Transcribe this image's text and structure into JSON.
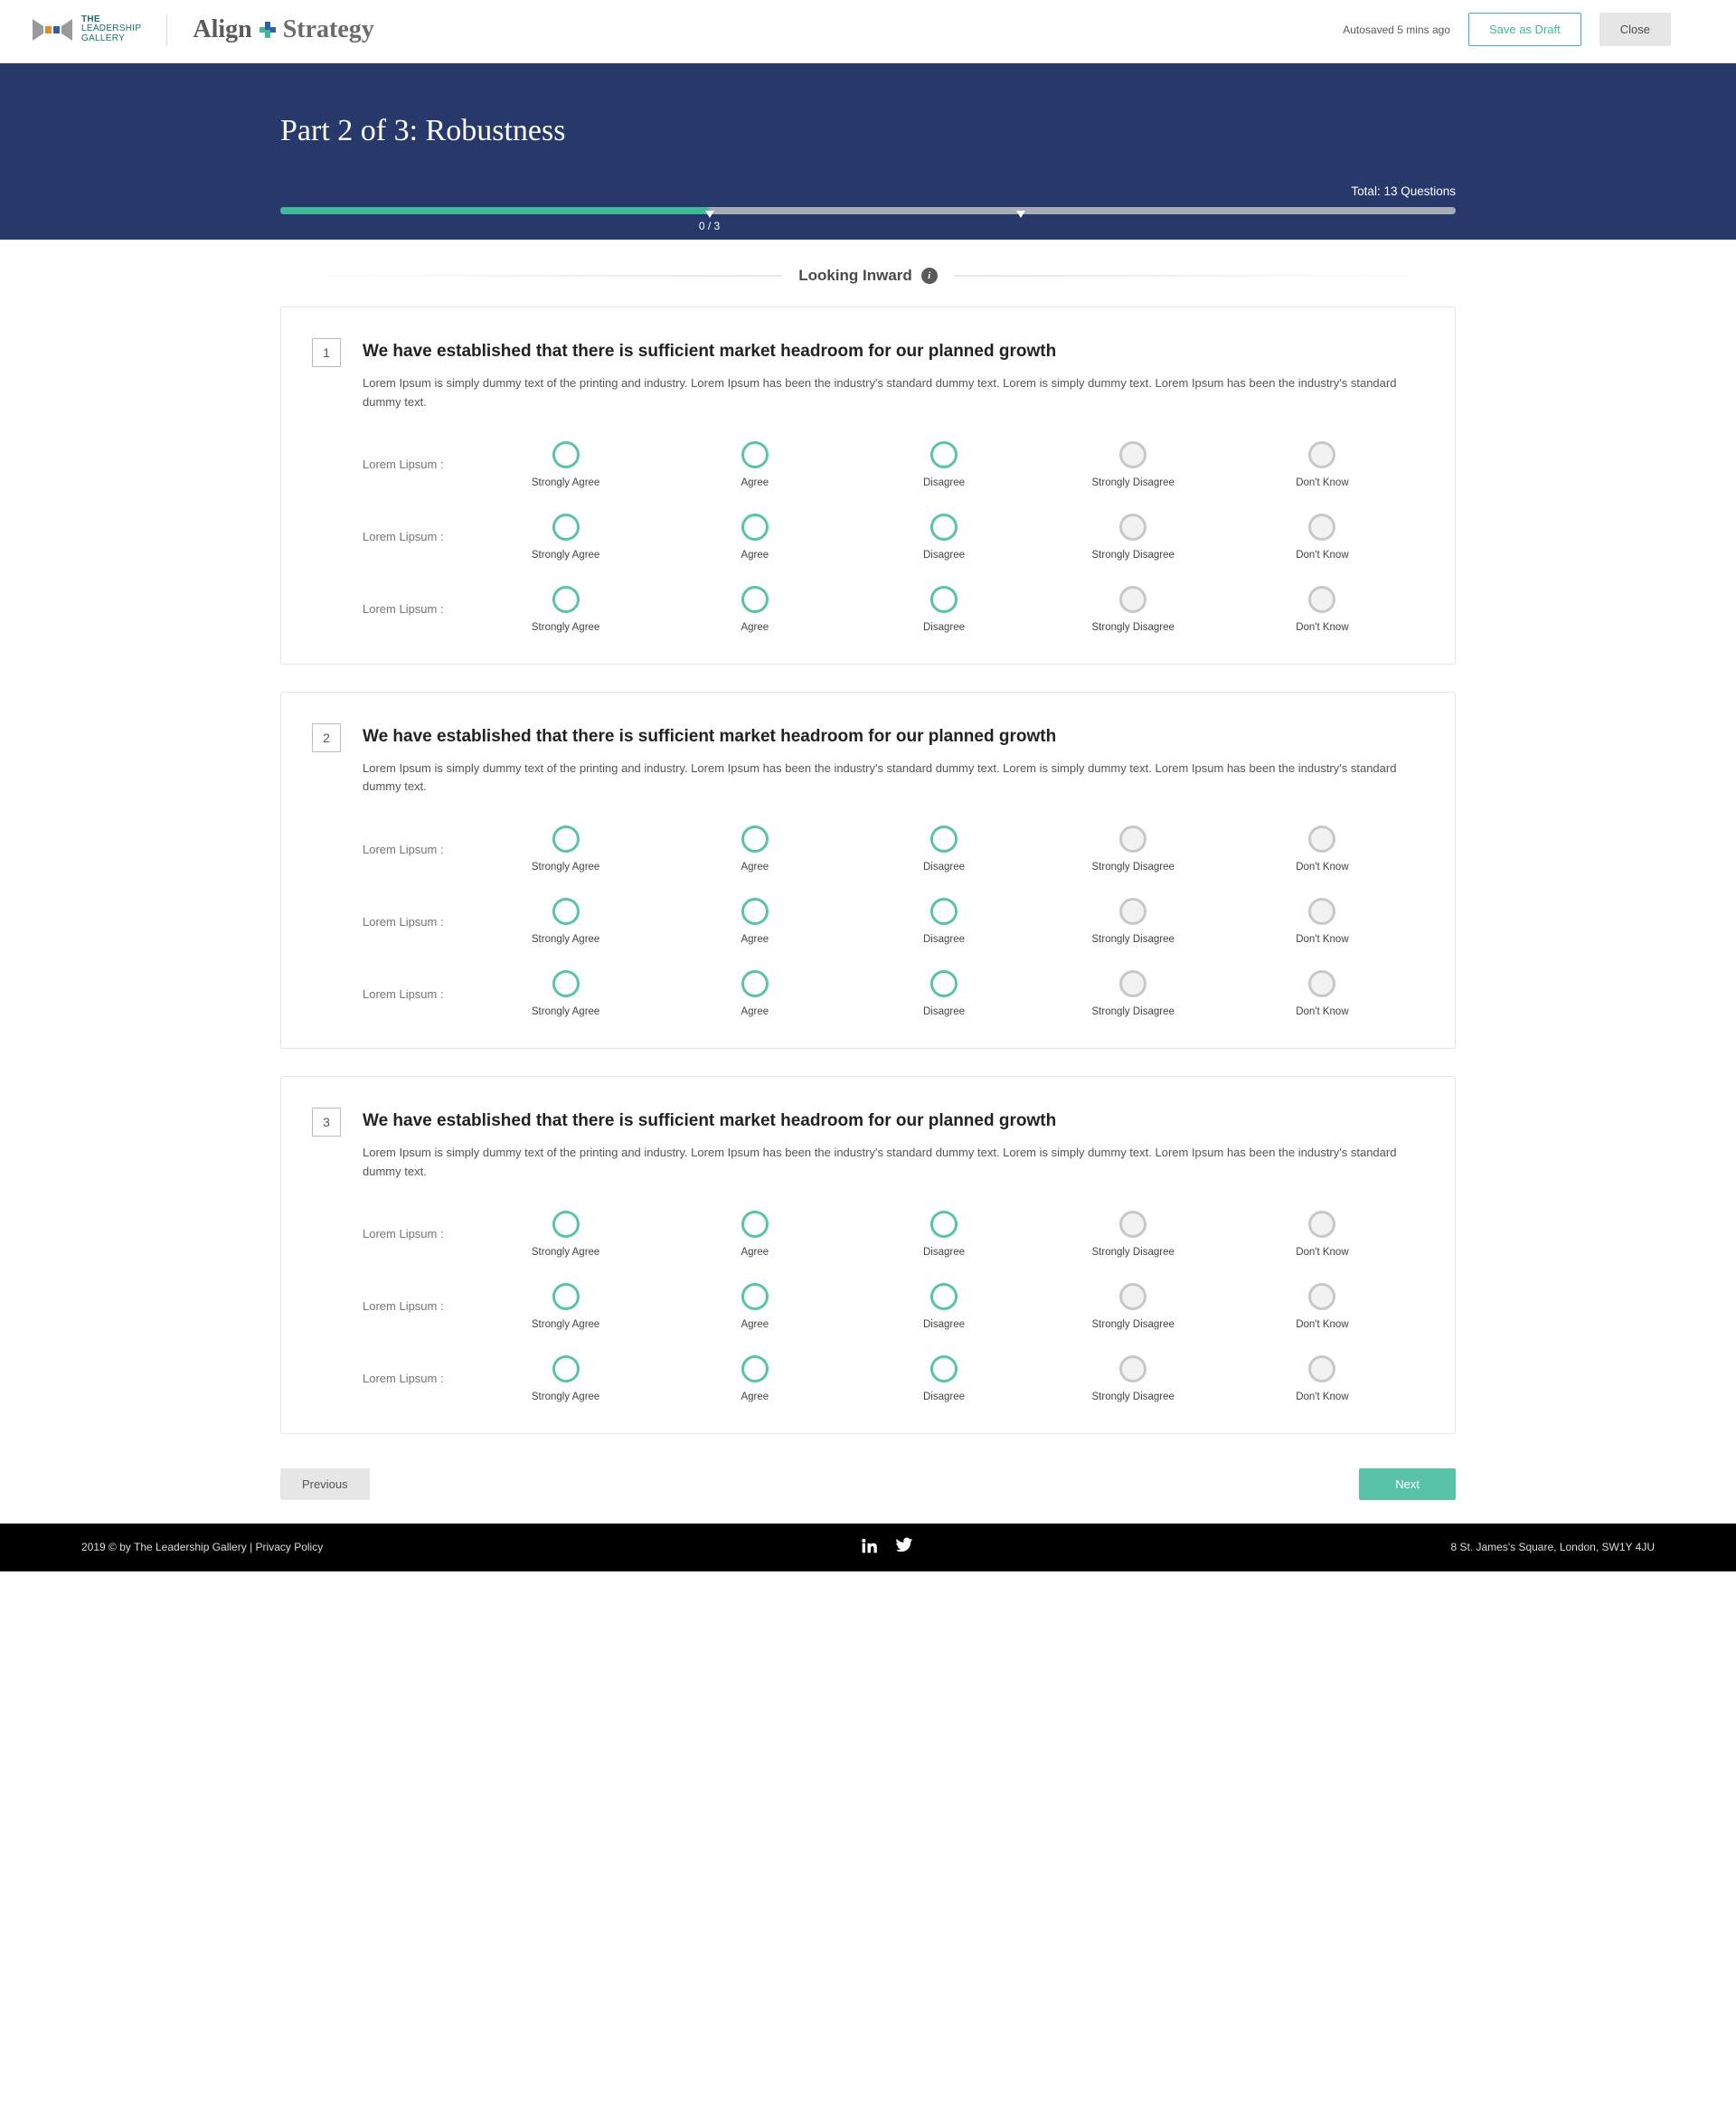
{
  "header": {
    "logo1": {
      "line1": "THE",
      "line2": "LEADERSHIP",
      "line3": "GALLERY"
    },
    "logo2": {
      "part1": "Align",
      "part2": "Strategy"
    },
    "autosave": "Autosaved 5 mins ago",
    "save_draft": "Save as Draft",
    "close": "Close"
  },
  "banner": {
    "title": "Part 2 of 3: Robustness",
    "total": "Total: 13 Questions",
    "progress_label": "0 / 3"
  },
  "section": {
    "label": "Looking Inward"
  },
  "option_labels": [
    "Strongly Agree",
    "Agree",
    "Disagree",
    "Strongly Disagree",
    "Don't Know"
  ],
  "row_label": "Lorem Lipsum :",
  "questions": [
    {
      "num": "1",
      "title": "We have established that there is sufficient market headroom for our planned growth",
      "desc": "Lorem Ipsum is simply dummy text of the printing and industry. Lorem Ipsum has been the industry's standard dummy text. Lorem is simply dummy text. Lorem Ipsum has been the industry's standard dummy text."
    },
    {
      "num": "2",
      "title": "We have established that there is sufficient market headroom for our planned growth",
      "desc": "Lorem Ipsum is simply dummy text of the printing and industry. Lorem Ipsum has been the industry's standard dummy text. Lorem is simply dummy text. Lorem Ipsum has been the industry's standard dummy text."
    },
    {
      "num": "3",
      "title": "We have established that there is sufficient market headroom for our planned growth",
      "desc": "Lorem Ipsum is simply dummy text of the printing and industry. Lorem Ipsum has been the industry's standard dummy text. Lorem is simply dummy text. Lorem Ipsum has been the industry's standard dummy text."
    }
  ],
  "nav": {
    "previous": "Previous",
    "next": "Next"
  },
  "footer": {
    "copyright": "2019 © by The Leadership Gallery",
    "sep": " | ",
    "privacy": "Privacy Policy",
    "address": "8 St. James's Square, London, SW1Y 4JU"
  }
}
